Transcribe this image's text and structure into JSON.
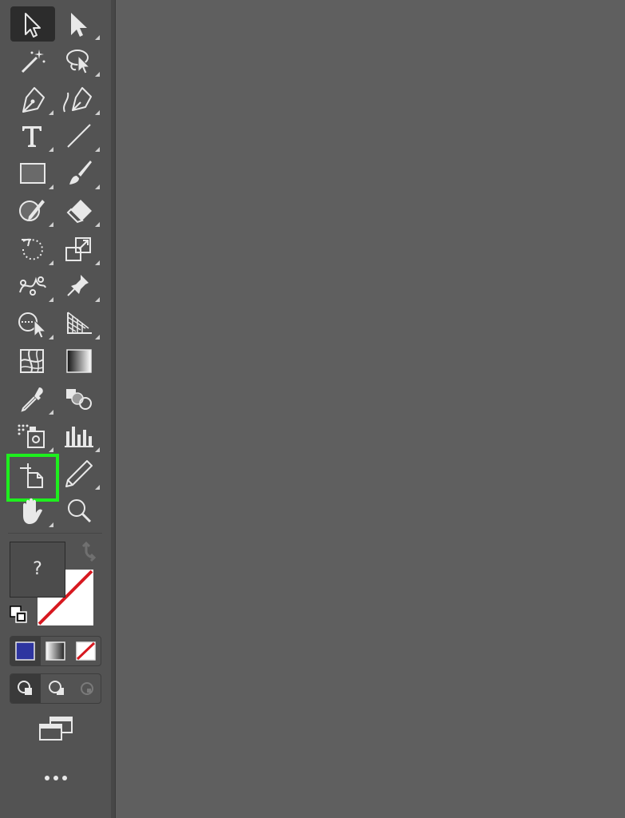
{
  "app": {
    "fill_stroke": {
      "fill_label": "?",
      "fill_indicator": "unknown",
      "stroke_color": "none"
    },
    "color_modes": [
      {
        "name": "color",
        "color": "#2e35a0"
      },
      {
        "name": "gradient",
        "color": "gradient"
      },
      {
        "name": "none",
        "color": "none"
      }
    ],
    "draw_modes": [
      "draw-normal",
      "draw-behind",
      "draw-inside"
    ],
    "more_tools_label": "•••",
    "accent_highlight": "#1eef1e",
    "tools": [
      {
        "name": "selection-tool",
        "icon": "selection-arrow-icon"
      },
      {
        "name": "direct-selection-tool",
        "icon": "direct-selection-arrow-icon"
      },
      {
        "name": "magic-wand-tool",
        "icon": "magic-wand-icon"
      },
      {
        "name": "lasso-tool",
        "icon": "lasso-icon"
      },
      {
        "name": "pen-tool",
        "icon": "pen-icon"
      },
      {
        "name": "curvature-tool",
        "icon": "curvature-pen-icon"
      },
      {
        "name": "type-tool",
        "icon": "type-icon"
      },
      {
        "name": "line-segment-tool",
        "icon": "line-icon"
      },
      {
        "name": "rectangle-tool",
        "icon": "rectangle-icon"
      },
      {
        "name": "paintbrush-tool",
        "icon": "paintbrush-icon"
      },
      {
        "name": "shaper-tool",
        "icon": "shaper-icon"
      },
      {
        "name": "eraser-tool",
        "icon": "eraser-icon"
      },
      {
        "name": "rotate-tool",
        "icon": "rotate-icon"
      },
      {
        "name": "scale-tool",
        "icon": "scale-icon"
      },
      {
        "name": "puppet-warp-tool",
        "icon": "puppet-warp-icon"
      },
      {
        "name": "free-transform-tool",
        "icon": "pin-icon"
      },
      {
        "name": "shape-builder-tool",
        "icon": "shape-builder-icon"
      },
      {
        "name": "perspective-grid-tool",
        "icon": "perspective-grid-icon"
      },
      {
        "name": "mesh-tool",
        "icon": "mesh-icon"
      },
      {
        "name": "gradient-tool",
        "icon": "gradient-icon"
      },
      {
        "name": "eyedropper-tool",
        "icon": "eyedropper-icon"
      },
      {
        "name": "blend-tool",
        "icon": "blend-icon"
      },
      {
        "name": "symbol-sprayer-tool",
        "icon": "symbol-sprayer-icon"
      },
      {
        "name": "column-graph-tool",
        "icon": "column-graph-icon"
      },
      {
        "name": "artboard-tool",
        "icon": "artboard-icon"
      },
      {
        "name": "slice-tool",
        "icon": "slice-icon"
      },
      {
        "name": "hand-tool",
        "icon": "hand-icon"
      },
      {
        "name": "zoom-tool",
        "icon": "zoom-icon"
      }
    ]
  }
}
